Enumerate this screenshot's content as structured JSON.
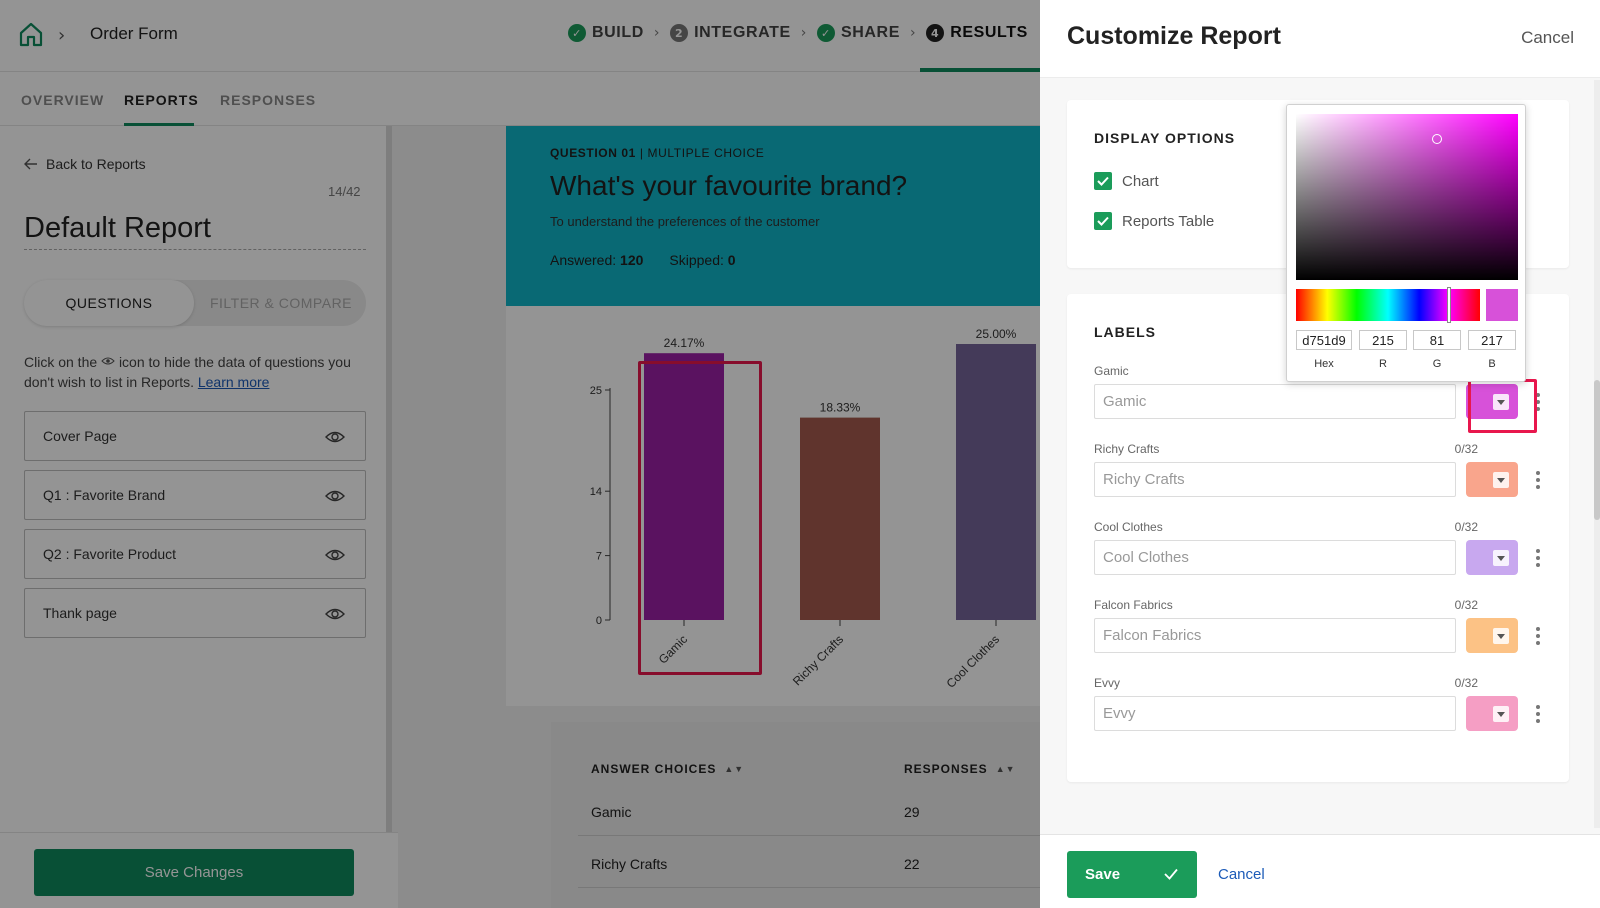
{
  "topbar": {
    "form_name": "Order Form",
    "steps": [
      {
        "label": "BUILD",
        "marker": "✓"
      },
      {
        "label": "INTEGRATE",
        "marker": "2"
      },
      {
        "label": "SHARE",
        "marker": "✓"
      },
      {
        "label": "RESULTS",
        "marker": "4"
      }
    ]
  },
  "subtabs": [
    "OVERVIEW",
    "REPORTS",
    "RESPONSES"
  ],
  "left": {
    "back_label": "Back to Reports",
    "page_count": "14/42",
    "report_title": "Default Report",
    "seg_questions": "QUESTIONS",
    "seg_filter": "FILTER & COMPARE",
    "hint_before": "Click on the",
    "hint_after": "icon to hide the data of questions you don't wish to list in Reports.",
    "hint_link": "Learn more",
    "items": [
      "Cover Page",
      "Q1 : Favorite Brand",
      "Q2 : Favorite Product",
      "Thank page"
    ],
    "save_changes": "Save Changes"
  },
  "question": {
    "number_label": "QUESTION 01",
    "type_label": "| MULTIPLE CHOICE",
    "title": "What's your favourite brand?",
    "description": "To understand the preferences of the customer",
    "answered_label": "Answered:",
    "answered_value": "120",
    "skipped_label": "Skipped:",
    "skipped_value": "0"
  },
  "chart_data": {
    "type": "bar",
    "categories": [
      "Gamic",
      "Richy Crafts",
      "Cool Clothes"
    ],
    "values": [
      29,
      22,
      30
    ],
    "data_labels": [
      "24.17%",
      "18.33%",
      "25.00%"
    ],
    "colors": [
      "#9b1fa6",
      "#a55a4e",
      "#76649a"
    ],
    "y_ticks": [
      0,
      7,
      14,
      25
    ],
    "ylim": [
      0,
      30
    ]
  },
  "table": {
    "col_answer": "ANSWER CHOICES",
    "col_responses": "RESPONSES",
    "rows": [
      {
        "choice": "Gamic",
        "responses": "29"
      },
      {
        "choice": "Richy Crafts",
        "responses": "22"
      }
    ]
  },
  "drawer": {
    "title": "Customize Report",
    "cancel": "Cancel",
    "display_options_title": "DISPLAY OPTIONS",
    "option_chart": "Chart",
    "option_table": "Reports Table",
    "labels_title": "LABELS",
    "labels": [
      {
        "name": "Gamic",
        "placeholder": "Gamic",
        "count": "",
        "color": "#d751d9"
      },
      {
        "name": "Richy Crafts",
        "placeholder": "Richy Crafts",
        "count": "0/32",
        "color": "#f9a58c"
      },
      {
        "name": "Cool Clothes",
        "placeholder": "Cool Clothes",
        "count": "0/32",
        "color": "#c8a8ef"
      },
      {
        "name": "Falcon Fabrics",
        "placeholder": "Falcon Fabrics",
        "count": "0/32",
        "color": "#fcc285"
      },
      {
        "name": "Evvy",
        "placeholder": "Evvy",
        "count": "0/32",
        "color": "#f59ec4"
      }
    ],
    "save": "Save",
    "foot_cancel": "Cancel"
  },
  "picker": {
    "hex": "d751d9",
    "r": "215",
    "g": "81",
    "b": "217",
    "hex_label": "Hex",
    "r_label": "R",
    "g_label": "G",
    "b_label": "B",
    "preview_color": "#d751d9"
  }
}
